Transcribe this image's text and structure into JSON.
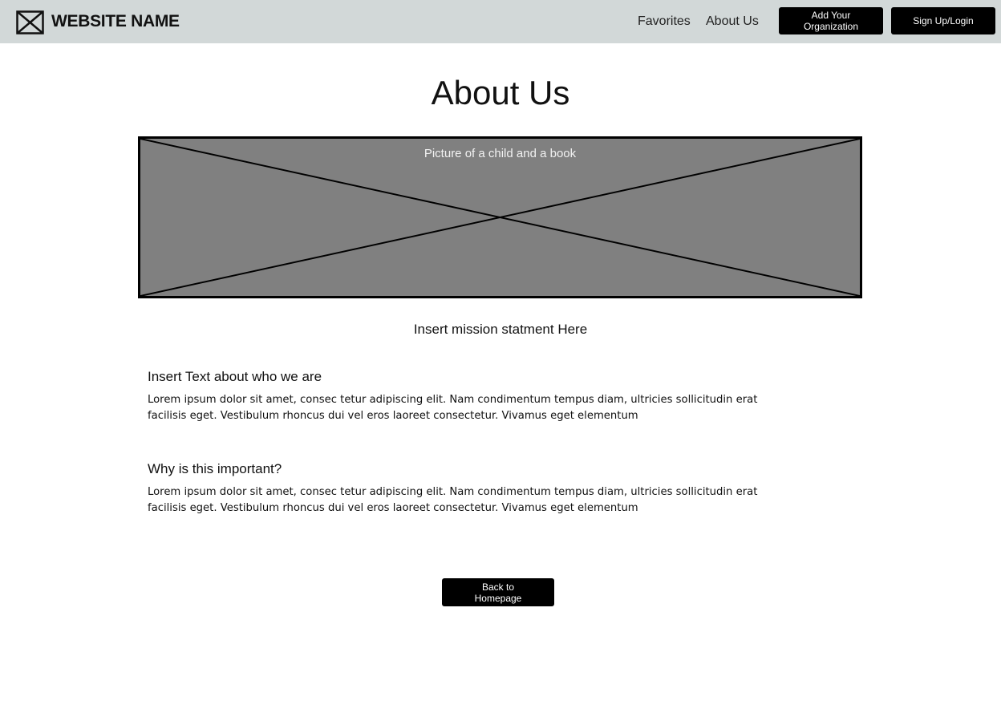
{
  "header": {
    "site_name": "WEBSITE NAME",
    "logo_icon": "image-placeholder-icon",
    "nav": {
      "favorites": "Favorites",
      "about_us": "About Us"
    },
    "buttons": {
      "add_organization": "Add Your Organization",
      "signup_login": "Sign Up/Login"
    }
  },
  "main": {
    "title": "About Us",
    "hero_image": {
      "caption": "Picture of a child and a book"
    },
    "mission": "Insert mission statment Here",
    "sections": [
      {
        "heading": "Insert Text about who we are",
        "body": "Lorem ipsum dolor sit amet, consec tetur adipiscing elit. Nam condimentum tempus diam, ultricies sollicitudin erat facilisis eget. Vestibulum rhoncus dui vel eros laoreet consectetur. Vivamus eget elementum"
      },
      {
        "heading": "Why is this important?",
        "body": "Lorem ipsum dolor sit amet, consec tetur adipiscing elit. Nam condimentum tempus diam, ultricies sollicitudin erat facilisis eget. Vestibulum rhoncus dui vel eros laoreet consectetur. Vivamus eget elementum"
      }
    ],
    "back_button": "Back to Homepage"
  },
  "colors": {
    "navbar_bg": "#d2d8d8",
    "button_bg": "#000000",
    "image_placeholder_bg": "#808080"
  }
}
